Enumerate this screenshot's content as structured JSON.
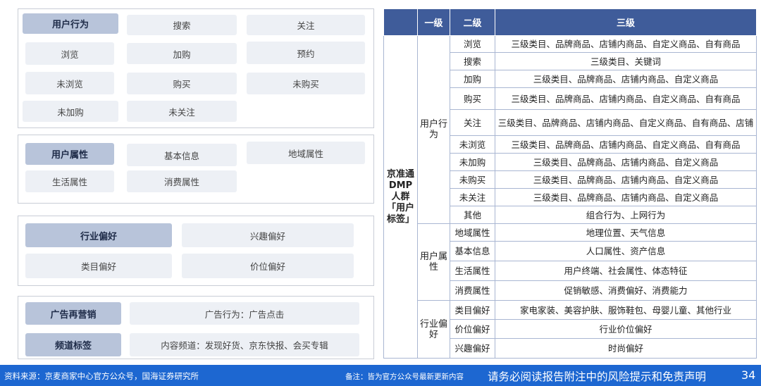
{
  "panels": {
    "behavior": {
      "head": "用户行为",
      "chips": [
        "搜索",
        "关注",
        "浏览",
        "加购",
        "预约",
        "未浏览",
        "购买",
        "未购买",
        "未加购",
        "未关注"
      ]
    },
    "attributes": {
      "head": "用户属性",
      "chips": [
        "基本信息",
        "地域属性",
        "生活属性",
        "消费属性"
      ]
    },
    "preference": {
      "head": "行业偏好",
      "chips": [
        "兴趣偏好",
        "类目偏好",
        "价位偏好"
      ]
    },
    "ads": {
      "head1": "广告再营销",
      "text1": "广告行为：广告点击",
      "head2": "频道标签",
      "text2": "内容频道：发现好货、京东快报、会买专辑"
    }
  },
  "table": {
    "headers": [
      "一级",
      "二级",
      "三级"
    ],
    "root": "京准通DMP人群「用户标签」",
    "groups": [
      {
        "label": "用户行为",
        "rows": [
          {
            "l2": "浏览",
            "l3": "三级类目、品牌商品、店铺内商品、自定义商品、自有商品"
          },
          {
            "l2": "搜索",
            "l3": "三级类目、关键词"
          },
          {
            "l2": "加购",
            "l3": "三级类目、品牌商品、店铺内商品、自定义商品"
          },
          {
            "l2": "购买",
            "l3": "三级类目、品牌商品、店铺内商品、自定义商品、自有商品"
          },
          {
            "l2": "关注",
            "l3": "三级类目、品牌商品、店铺内商品、自定义商品、自有商品、店铺"
          },
          {
            "l2": "未浏览",
            "l3": "三级类目、品牌商品、店铺内商品、自定义商品、自有商品"
          },
          {
            "l2": "未加购",
            "l3": "三级类目、品牌商品、店铺内商品、自定义商品"
          },
          {
            "l2": "未购买",
            "l3": "三级类目、品牌商品、店铺内商品、自定义商品"
          },
          {
            "l2": "未关注",
            "l3": "三级类目、品牌商品、店铺内商品、自定义商品"
          },
          {
            "l2": "其他",
            "l3": "组合行为、上网行为"
          }
        ]
      },
      {
        "label": "用户属性",
        "rows": [
          {
            "l2": "地域属性",
            "l3": "地理位置、天气信息"
          },
          {
            "l2": "基本信息",
            "l3": "人口属性、资产信息"
          },
          {
            "l2": "生活属性",
            "l3": "用户终端、社会属性、体态特征"
          },
          {
            "l2": "消费属性",
            "l3": "促销敏感、消费偏好、消费能力"
          }
        ]
      },
      {
        "label": "行业偏好",
        "rows": [
          {
            "l2": "类目偏好",
            "l3": "家电家装、美容护肤、服饰鞋包、母婴儿童、其他行业"
          },
          {
            "l2": "价位偏好",
            "l3": "行业价位偏好"
          },
          {
            "l2": "兴趣偏好",
            "l3": "时尚偏好"
          }
        ]
      }
    ]
  },
  "footer": {
    "source": "资料来源：京麦商家中心官方公众号，国海证券研究所",
    "note": "备注：皆为官方公众号最新更新内容",
    "disclaimer": "请务必阅读报告附注中的风险提示和免责声明",
    "page": "34"
  }
}
